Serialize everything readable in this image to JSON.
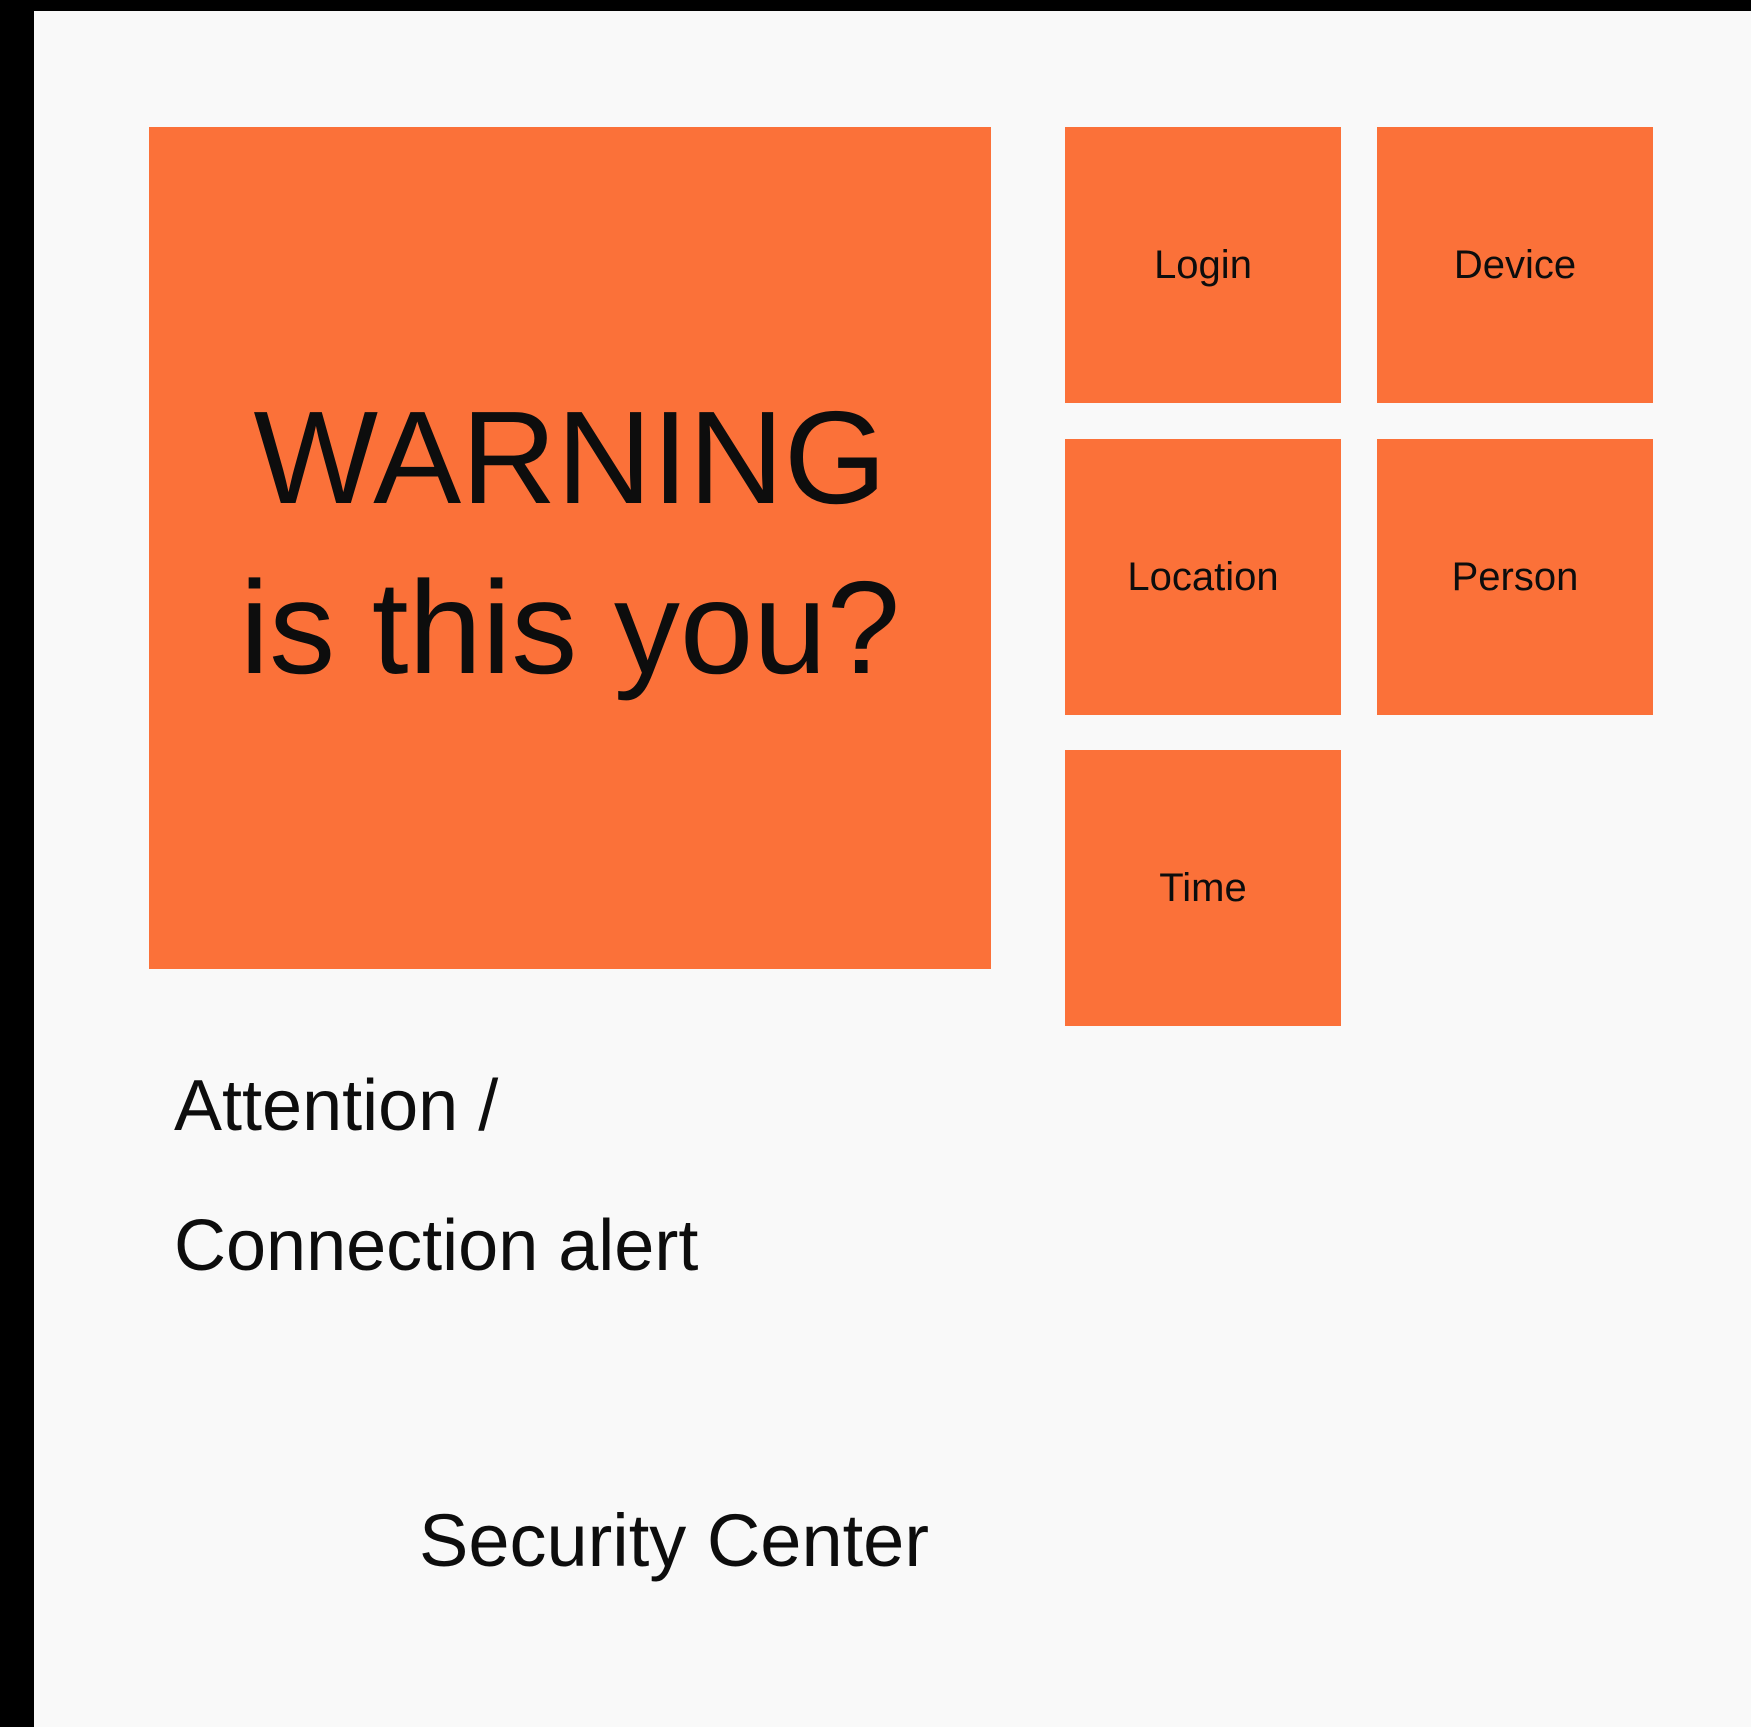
{
  "theme": {
    "tile_color": "#fb7139",
    "background": "#f9f9f9",
    "frame": "#000000"
  },
  "hero": {
    "line1": "WARNING",
    "line2": "is this you?"
  },
  "tiles": [
    {
      "label": "Login"
    },
    {
      "label": "Device"
    },
    {
      "label": "Location"
    },
    {
      "label": "Person"
    },
    {
      "label": "Time"
    }
  ],
  "caption": {
    "line1": "Attention /",
    "line2": "Connection alert"
  },
  "footer": {
    "title": "Security Center"
  }
}
